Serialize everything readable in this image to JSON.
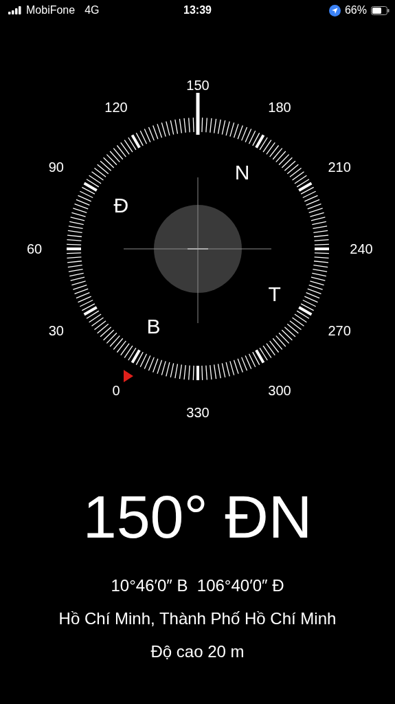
{
  "status_bar": {
    "carrier": "MobiFone",
    "network": "4G",
    "time": "13:39",
    "battery_percent": "66%"
  },
  "compass": {
    "degree_labels": [
      "0",
      "30",
      "60",
      "90",
      "120",
      "150",
      "180",
      "210",
      "240",
      "270",
      "300",
      "330"
    ],
    "cardinals": [
      "B",
      "Đ",
      "N",
      "T"
    ]
  },
  "heading": "150° ĐN",
  "coordinates": "10°46′0″ B  106°40′0″ Đ",
  "location": "Hồ Chí Minh, Thành Phố Hồ Chí Minh",
  "altitude": "Độ cao 20 m"
}
